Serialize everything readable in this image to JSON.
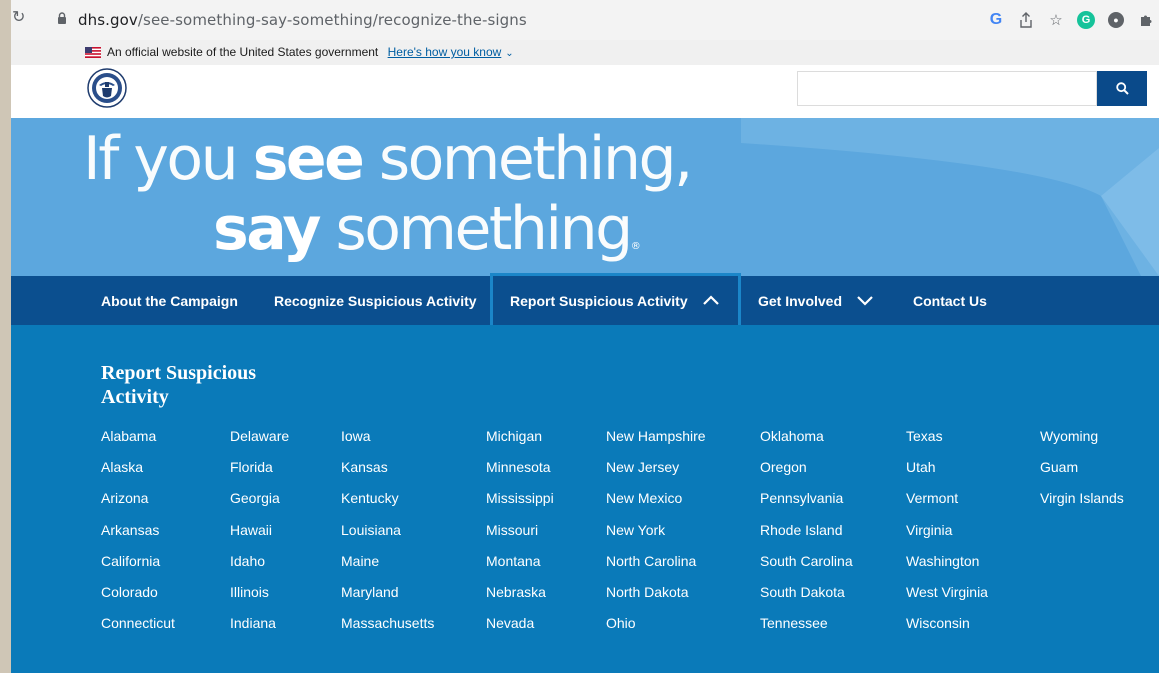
{
  "browser": {
    "url_host": "dhs.gov",
    "url_path": "/see-something-say-something/recognize-the-signs"
  },
  "gov_banner": {
    "text": "An official website of the United States government",
    "link": "Here's how you know"
  },
  "search": {
    "placeholder": "",
    "value": ""
  },
  "hero": {
    "w1": "If you ",
    "w2": "see",
    "w3": " something,",
    "w4": "say",
    "w5": " something",
    "reg": "®"
  },
  "nav": {
    "items": [
      {
        "label": "About the Campaign"
      },
      {
        "label": "Recognize Suspicious Activity"
      },
      {
        "label": "Report Suspicious Activity"
      },
      {
        "label": "Get Involved"
      },
      {
        "label": "Contact Us"
      }
    ]
  },
  "dropdown": {
    "title": "Report Suspicious Activity",
    "columns": [
      [
        "Alabama",
        "Alaska",
        "Arizona",
        "Arkansas",
        "California",
        "Colorado",
        "Connecticut"
      ],
      [
        "Delaware",
        "Florida",
        "Georgia",
        "Hawaii",
        "Idaho",
        "Illinois",
        "Indiana"
      ],
      [
        "Iowa",
        "Kansas",
        "Kentucky",
        "Louisiana",
        "Maine",
        "Maryland",
        "Massachusetts"
      ],
      [
        "Michigan",
        "Minnesota",
        "Mississippi",
        "Missouri",
        "Montana",
        "Nebraska",
        "Nevada"
      ],
      [
        "New Hampshire",
        "New Jersey",
        "New Mexico",
        "New York",
        "North Carolina",
        "North Dakota",
        "Ohio"
      ],
      [
        "Oklahoma",
        "Oregon",
        "Pennsylvania",
        "Rhode Island",
        "South Carolina",
        "South Dakota",
        "Tennessee"
      ],
      [
        "Texas",
        "Utah",
        "Vermont",
        "Virginia",
        "Washington",
        "West Virginia",
        "Wisconsin"
      ],
      [
        "Wyoming",
        "Guam",
        "Virgin Islands"
      ]
    ]
  },
  "colors": {
    "hero_bg": "#5ca7de",
    "nav_bg": "#0b4f8f",
    "dropdown_bg": "#0a7ab9",
    "search_btn": "#0a4a8a",
    "link_blue": "#005ea2"
  },
  "icons": [
    "reload-icon",
    "lock-icon",
    "google-icon",
    "share-icon",
    "star-icon",
    "grammarly-icon",
    "extension-icon",
    "puzzle-icon",
    "us-flag-icon",
    "dhs-seal-icon",
    "search-icon",
    "chevron-up-icon",
    "chevron-down-icon"
  ]
}
